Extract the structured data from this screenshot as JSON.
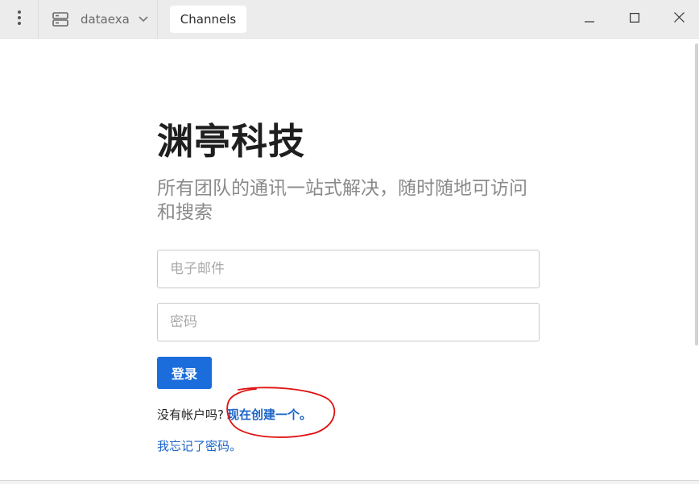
{
  "titlebar": {
    "menu_icon": "vertical-dots-icon",
    "server_icon": "server-icon",
    "server_name": "dataexa",
    "chevron_icon": "chevron-down-icon",
    "channels_tab_label": "Channels",
    "window_controls": [
      "minimize-icon",
      "maximize-icon",
      "close-icon"
    ]
  },
  "login": {
    "brand_title": "渊亭科技",
    "tagline": "所有团队的通讯一站式解决，随时随地可访问和搜索",
    "email_placeholder": "电子邮件",
    "password_placeholder": "密码",
    "login_button_label": "登录",
    "signup_prompt": "没有帐户吗?",
    "signup_link": "现在创建一个。",
    "forgot_password_link": "我忘记了密码。"
  },
  "colors": {
    "accent": "#1c6ddc",
    "link": "#1c64c8",
    "annotation_circle": "#e01010"
  }
}
